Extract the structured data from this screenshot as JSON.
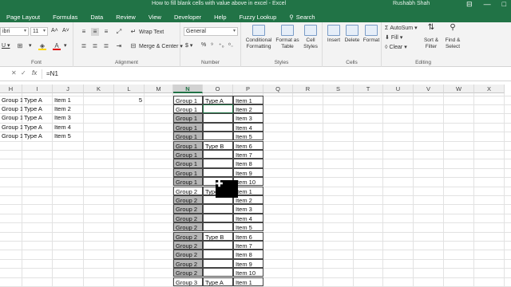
{
  "window": {
    "title": "How to fill blank cells with value above in excel - Excel",
    "user": "Rushabh Shah",
    "controls": [
      "⊟",
      "—",
      "□"
    ]
  },
  "tabs": [
    "Page Layout",
    "Formulas",
    "Data",
    "Review",
    "View",
    "Developer",
    "Help",
    "Fuzzy Lookup"
  ],
  "search_label": "Search",
  "ribbon": {
    "font_name": "ibri",
    "font_size": "11",
    "wrap_text": "Wrap Text",
    "merge_center": "Merge & Center",
    "number_format": "General",
    "conditional_formatting": "Conditional Formatting",
    "format_as_table": "Format as Table",
    "cell_styles": "Cell Styles",
    "insert": "Insert",
    "delete": "Delete",
    "format": "Format",
    "autosum": "AutoSum",
    "fill": "Fill",
    "clear": "Clear",
    "sort_filter": "Sort & Filter",
    "find_select": "Find & Select",
    "groups": {
      "font": "Font",
      "alignment": "Alignment",
      "number": "Number",
      "styles": "Styles",
      "cells": "Cells",
      "editing": "Editing"
    }
  },
  "formula_bar": {
    "content": "=N1"
  },
  "columns": [
    "H",
    "I",
    "J",
    "K",
    "L",
    "M",
    "N",
    "O",
    "P",
    "Q",
    "R",
    "S",
    "T",
    "U",
    "V",
    "W",
    "X"
  ],
  "selected_column": "N",
  "left_table": {
    "groups": [
      "Group 1",
      "Group 1",
      "Group 1",
      "Group 1",
      "Group 1"
    ],
    "types": [
      "Type A",
      "Type A",
      "Type A",
      "Type A",
      "Type A"
    ],
    "items": [
      "Item 1",
      "Item 2",
      "Item 3",
      "Item 4",
      "Item 5"
    ],
    "count": "5"
  },
  "main_table": {
    "groups": [
      "Group 1",
      "Group 1",
      "Group 1",
      "Group 1",
      "Group 1",
      "Group 1",
      "Group 1",
      "Group 1",
      "Group 1",
      "Group 1",
      "Group 2",
      "Group 2",
      "Group 2",
      "Group 2",
      "Group 2",
      "Group 2",
      "Group 2",
      "Group 2",
      "Group 2",
      "Group 2",
      "Group 3"
    ],
    "types": [
      "Type A",
      "",
      "",
      "",
      "",
      "Type B",
      "",
      "",
      "",
      "",
      "Type A",
      "",
      "",
      "",
      "",
      "Type B",
      "",
      "",
      "",
      "",
      "Type A"
    ],
    "items": [
      "Item 1",
      "Item 2",
      "Item 3",
      "Item 4",
      "Item 5",
      "Item 6",
      "Item 7",
      "Item 8",
      "Item 9",
      "Item 10",
      "Item 1",
      "Item 2",
      "Item 3",
      "Item 4",
      "Item 5",
      "Item 6",
      "Item 7",
      "Item 8",
      "Item 9",
      "Item 10",
      "Item 1"
    ],
    "filled_blank_rows": [
      2,
      3,
      4,
      5,
      6,
      7,
      8,
      9,
      11,
      12,
      13,
      14,
      15,
      16,
      17,
      18,
      19
    ]
  },
  "colors": {
    "excel_green": "#217346",
    "filled_gray": "#b7b7b7"
  }
}
